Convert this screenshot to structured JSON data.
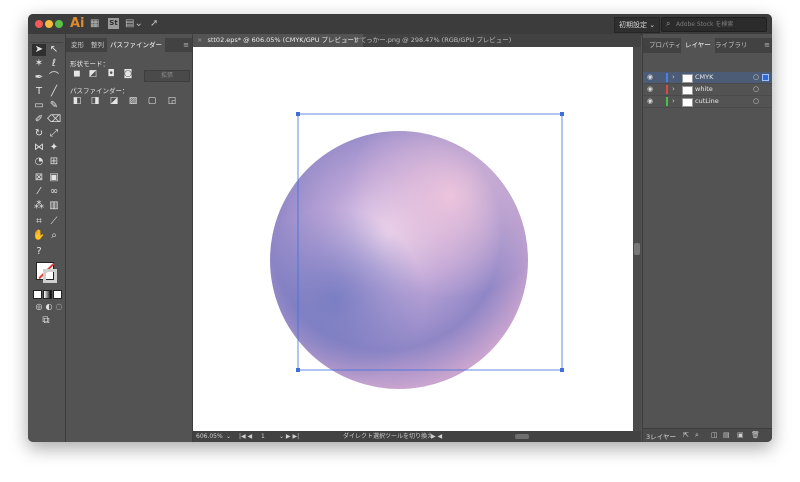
{
  "app": {
    "logo": "Ai",
    "stock_badge": "St"
  },
  "header": {
    "workspace_label": "初期設定 ⌄",
    "search_placeholder": "Adobe Stock を検索"
  },
  "left_panel": {
    "tabs": [
      "変形",
      "整列",
      "パスファインダー"
    ],
    "shape_mode_label": "形状モード：",
    "pathfinder_label": "パスファインダー：",
    "expand_button": "拡張"
  },
  "doc_tabs": [
    {
      "close": "×",
      "label": "stt02.eps* @ 606.05% (CMYK/GPU プレビュー)"
    },
    {
      "close": "×",
      "label": "すてっかー.png @ 298.47% (RGB/GPU プレビュー)"
    }
  ],
  "status": {
    "zoom": "606.05%",
    "artboard": "1",
    "tool_hint": "ダイレクト選択ツールを切り換え"
  },
  "right_panel": {
    "tabs": [
      "プロパティ",
      "レイヤー",
      "ライブラリ"
    ],
    "layers": [
      {
        "name": "CMYK",
        "color": "#4c7fe0",
        "selected": true
      },
      {
        "name": "white",
        "color": "#d64a4a",
        "selected": false
      },
      {
        "name": "cutLine",
        "color": "#49c24a",
        "selected": false
      }
    ],
    "footer_label": "3レイヤー"
  },
  "icons": {
    "close": "close-icon",
    "eye": "eye-icon",
    "search": "search-icon",
    "menu": "panel-menu-icon"
  }
}
